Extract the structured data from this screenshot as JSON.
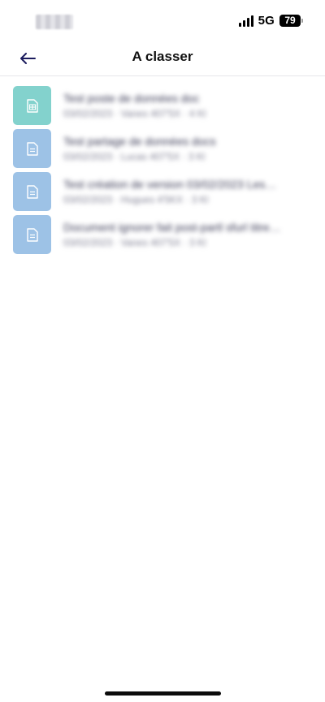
{
  "status_bar": {
    "network": "5G",
    "battery": "79"
  },
  "header": {
    "title": "A classer"
  },
  "documents": [
    {
      "icon": "spreadsheet-icon",
      "title": "Test poste de données doc",
      "meta": "03/02/2023 · Vanes 407'5X · 4 Kl"
    },
    {
      "icon": "document-icon",
      "title": "Test partage de données docs",
      "meta": "03/02/2023 · Lucas 407'5X · 3 Kl"
    },
    {
      "icon": "document-icon",
      "title": "Test création de version 03/02/2023 Les…",
      "meta": "03/02/2023 · Hugues 4'5KX · 3 Kl"
    },
    {
      "icon": "document-icon",
      "title": "Document ignorer fait post-partl sfurl titre…",
      "meta": "03/02/2023 · Vanes 407'5X · 3 Kl"
    }
  ]
}
